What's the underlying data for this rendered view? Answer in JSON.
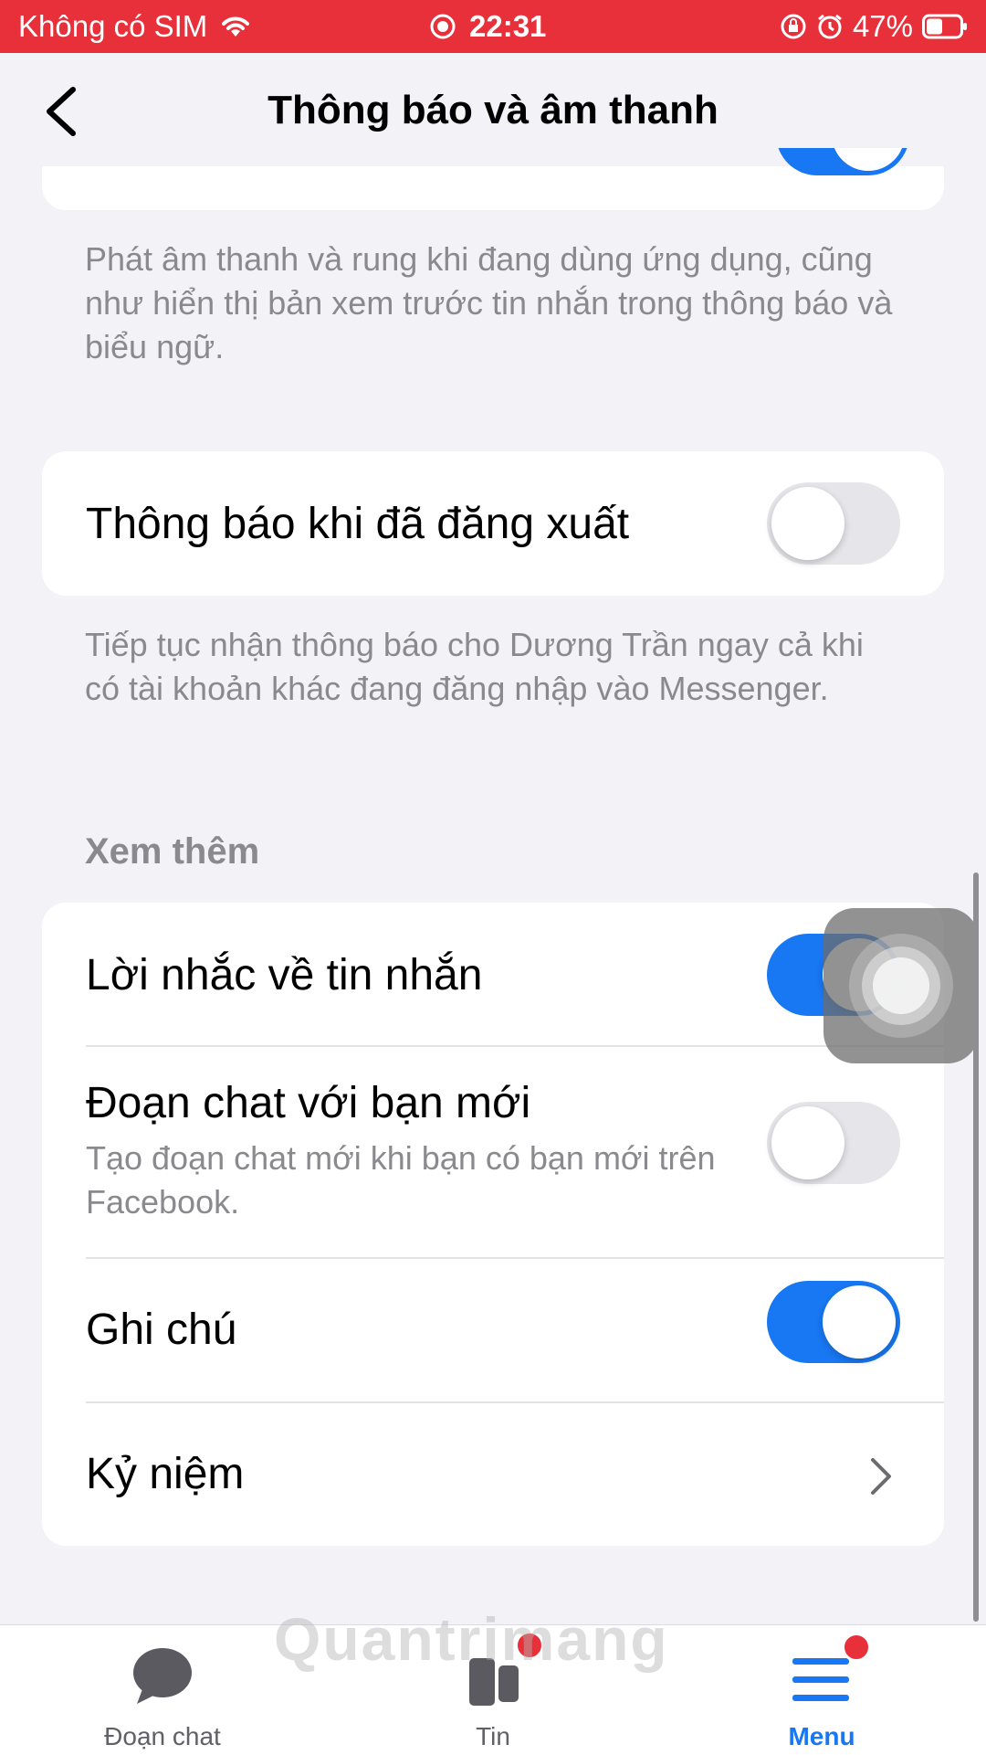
{
  "status_bar": {
    "carrier": "Không có SIM",
    "time": "22:31",
    "battery": "47%",
    "background": "#e8303a"
  },
  "header": {
    "title": "Thông báo và âm thanh"
  },
  "sections": {
    "in_app_description": "Phát âm thanh và rung khi đang dùng ứng dụng, cũng như hiển thị bản xem trước tin nhắn trong thông báo và biểu ngữ.",
    "logged_out": {
      "label": "Thông báo khi đã đăng xuất",
      "enabled": false,
      "description": "Tiếp tục nhận thông báo cho Dương Trần ngay cả khi có tài khoản khác đang đăng nhập vào Messenger."
    },
    "more": {
      "title": "Xem thêm",
      "items": [
        {
          "label": "Lời nhắc về tin nhắn",
          "enabled": true
        },
        {
          "label": "Đoạn chat với bạn mới",
          "subtitle": "Tạo đoạn chat mới khi bạn có bạn mới trên Facebook.",
          "enabled": false
        },
        {
          "label": "Ghi chú",
          "enabled": true
        },
        {
          "label": "Kỷ niệm",
          "type": "link"
        }
      ]
    }
  },
  "tabbar": {
    "tabs": [
      {
        "label": "Đoạn chat",
        "icon": "chat-bubble-icon",
        "active": false
      },
      {
        "label": "Tin",
        "icon": "stories-icon",
        "active": false,
        "badge": true
      },
      {
        "label": "Menu",
        "icon": "menu-icon",
        "active": true,
        "badge": true
      }
    ]
  },
  "watermark": "Quantrimang",
  "colors": {
    "accent": "#1877f2",
    "background": "#f2f2f7",
    "secondary_text": "#8a8a8e",
    "badge": "#e8303a"
  }
}
